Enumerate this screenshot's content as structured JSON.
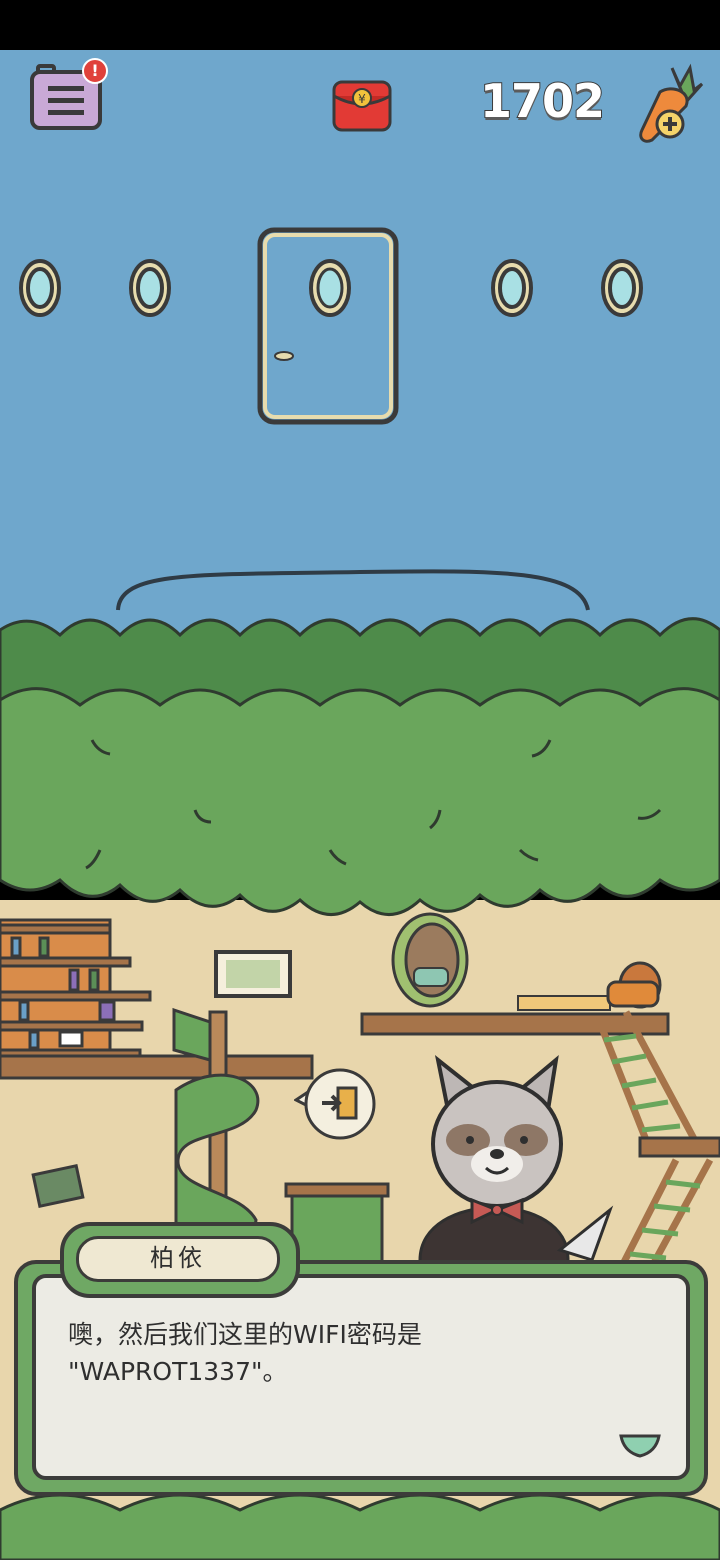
{
  "hud": {
    "menu_icon": "notebook-menu-icon",
    "alert_badge": "!",
    "red_packet_icon": "red-envelope-icon",
    "carrot_count": "1702",
    "carrot_icon": "carrot-add-icon"
  },
  "scene": {
    "exit_icon": "exit-door-icon"
  },
  "dialogue": {
    "speaker": "柏依",
    "text": "噢，然后我们这里的WIFI密码是\n\"WAPROT1337\"。",
    "continue_icon": "continue-arrow-icon"
  },
  "colors": {
    "sky": "#6fa7cc",
    "leaves": "#6aa65c",
    "wall": "#e8d6ac",
    "frame_green": "#6fa864",
    "paper": "#ecebe4"
  }
}
